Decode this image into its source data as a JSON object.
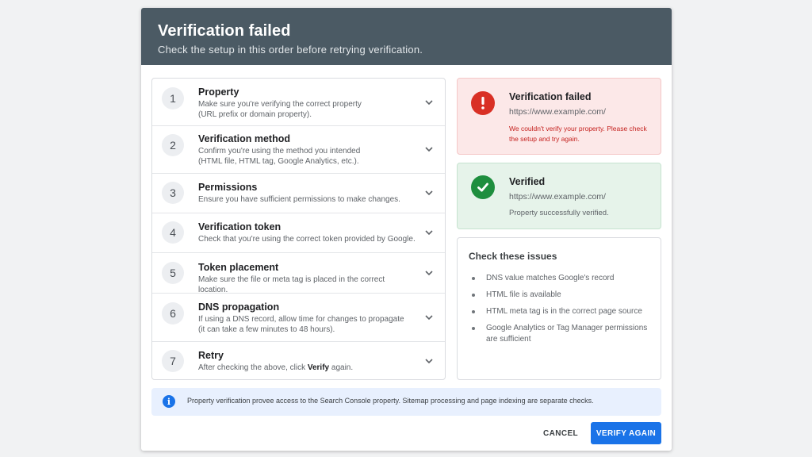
{
  "header": {
    "title": "Verification failed",
    "subtitle": "Check the setup in this order before retrying verification."
  },
  "steps": [
    {
      "number": "1",
      "title": "Property",
      "desc": [
        "Make sure you're verifying the correct property",
        "(URL prefix or domain property)."
      ]
    },
    {
      "number": "2",
      "title": "Verification method",
      "desc": [
        "Confirm you're using the method you intended",
        "(HTML file, HTML tag, Google Analytics, etc.)."
      ]
    },
    {
      "number": "3",
      "title": "Permissions",
      "desc": [
        "Ensure you have sufficient permissions to make changes."
      ]
    },
    {
      "number": "4",
      "title": "Verification token",
      "desc": [
        "Check that you're using the correct token provided by Google."
      ]
    },
    {
      "number": "5",
      "title": "Token placement",
      "desc": [
        "Make sure the file or meta tag is placed in the correct location."
      ]
    },
    {
      "number": "6",
      "title": "DNS propagation",
      "desc": [
        "If using a DNS record, allow time for changes to propagate",
        "(it can take a few minutes to 48 hours)."
      ]
    },
    {
      "number": "7",
      "title": "Retry",
      "desc_pre": "After checking the above, click ",
      "desc_bold": "Verify",
      "desc_post": " again."
    }
  ],
  "fail_card": {
    "title": "Verification failed",
    "url": "https://www.example.com/",
    "message_line1": "We couldn't verify your property. Please check",
    "message_line2": "the setup and try again.",
    "icon": "exclamation-icon",
    "color": "#d93025"
  },
  "ok_card": {
    "title": "Verified",
    "url": "https://www.example.com/",
    "message": "Property successfully verified.",
    "icon": "check-icon",
    "color": "#1e8e3e"
  },
  "issues": {
    "title": "Check these issues",
    "items": [
      "DNS value matches Google's record",
      "HTML file is available",
      "HTML meta tag is in the correct page source",
      "Google Analytics or Tag Manager permissions are sufficient"
    ]
  },
  "info": {
    "text": "Property verification provee access to the Search Console property. Sitemap processing and page indexing are separate checks."
  },
  "buttons": {
    "cancel": "CANCEL",
    "verify": "VERIFY AGAIN",
    "accent": "#1a73e8"
  }
}
